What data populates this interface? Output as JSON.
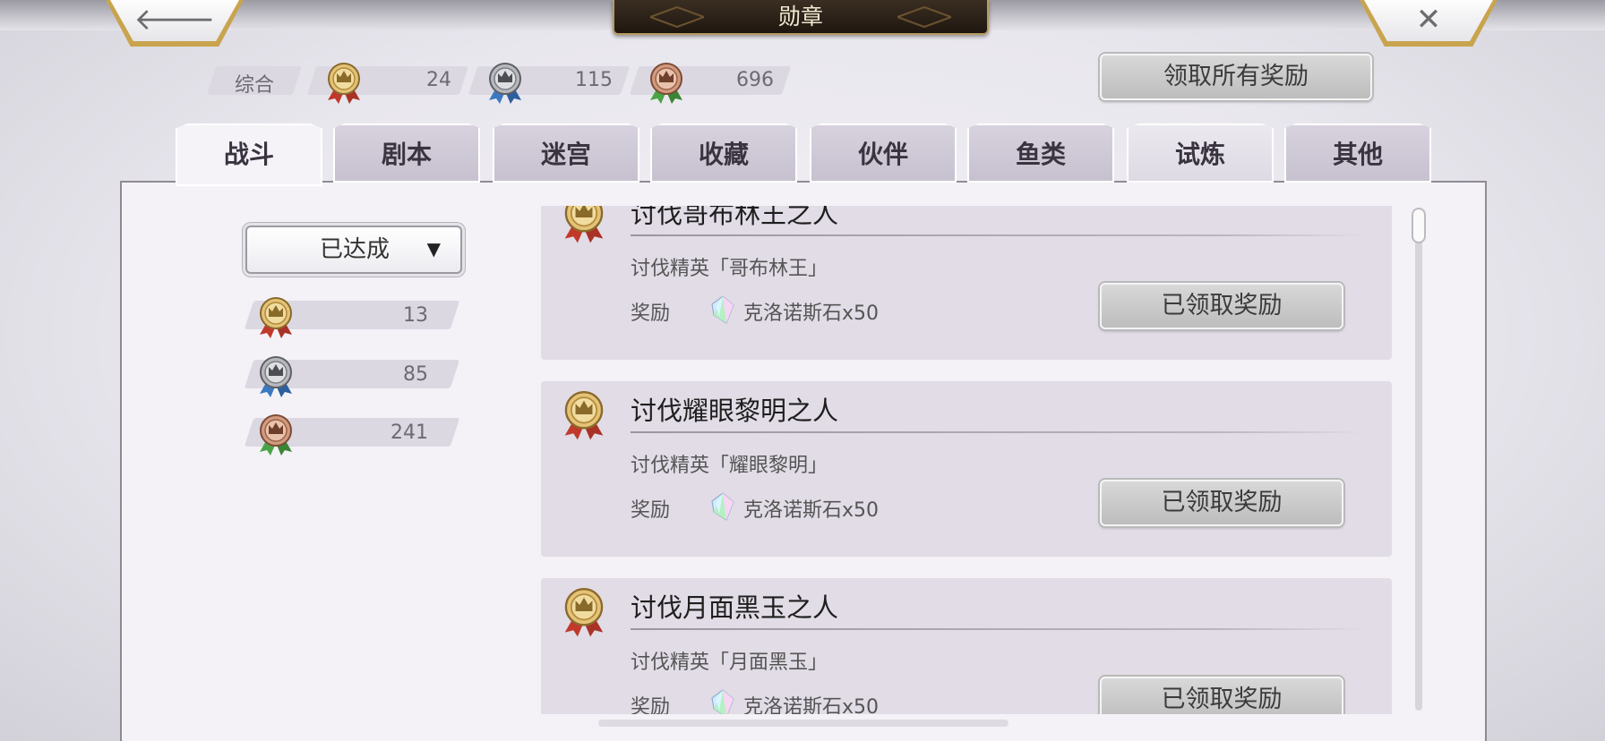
{
  "header": {
    "title": "勋章",
    "back_icon": "arrow-left-icon",
    "close_icon": "close-icon",
    "back_glyph": "🡐",
    "close_glyph": "✕"
  },
  "summary": {
    "label": "综合",
    "gold": "24",
    "silver": "115",
    "bronze": "696",
    "claim_all": "领取所有奖励"
  },
  "tabs": [
    {
      "label": "战斗",
      "active": true
    },
    {
      "label": "剧本"
    },
    {
      "label": "迷宫"
    },
    {
      "label": "收藏"
    },
    {
      "label": "伙伴"
    },
    {
      "label": "鱼类"
    },
    {
      "label": "试炼"
    },
    {
      "label": "其他"
    }
  ],
  "filter": {
    "selected": "已达成",
    "caret": "▼",
    "counts": {
      "gold": "13",
      "silver": "85",
      "bronze": "241"
    }
  },
  "medals": [
    {
      "title": "讨伐哥布林王之人",
      "description": "讨伐精英「哥布林王」",
      "reward_label": "奖励",
      "reward_item": "克洛诺斯石x50",
      "status": "已领取奖励"
    },
    {
      "title": "讨伐耀眼黎明之人",
      "description": "讨伐精英「耀眼黎明」",
      "reward_label": "奖励",
      "reward_item": "克洛诺斯石x50",
      "status": "已领取奖励"
    },
    {
      "title": "讨伐月面黑玉之人",
      "description": "讨伐精英「月面黑玉」",
      "reward_label": "奖励",
      "reward_item": "克洛诺斯石x50",
      "status": "已领取奖励"
    }
  ],
  "colors": {
    "gold_medal": "#d9b45c",
    "silver_medal": "#a9aab0",
    "bronze_medal": "#c98a70",
    "ribbon_red": "#c0392b",
    "ribbon_blue": "#3b79c3",
    "ribbon_green": "#4aa446"
  }
}
